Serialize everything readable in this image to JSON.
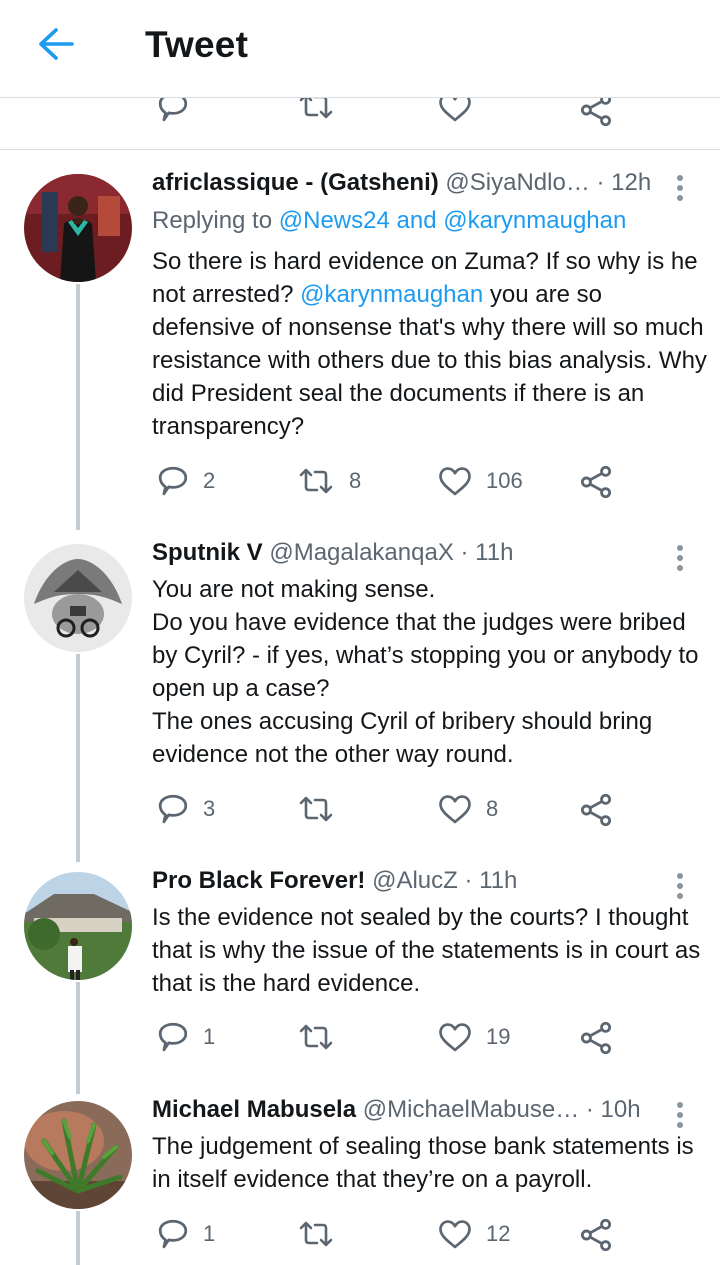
{
  "header": {
    "title": "Tweet"
  },
  "tweets": [
    {
      "name": "africlassique - (Gatsheni)",
      "handle": "@SiyaNdlo…",
      "time": "· 12h",
      "replying_label": "Replying to",
      "replying_to_1": "@News24",
      "replying_and": "and",
      "replying_to_2": "@karynmaughan",
      "text_1": "So there is hard evidence on Zuma? If so why is he not arrested?",
      "mention": "@karynmaughan",
      "text_2": "you are so defensive of nonsense that's why there will so much resistance with others due to this bias analysis. Why did President seal the documents if there is an transparency?",
      "replies": "2",
      "retweets": "8",
      "likes": "106"
    },
    {
      "name": "Sputnik V",
      "handle": "@MagalakanqaX",
      "time": "· 11h",
      "line_1": "You are not making sense.",
      "line_2": "Do you have evidence that the judges were bribed by Cyril? - if yes, what’s stopping you or anybody to open up a case?",
      "line_3": "The ones accusing Cyril of bribery should bring evidence not the other way round.",
      "replies": "3",
      "likes": "8"
    },
    {
      "name": "Pro Black Forever!",
      "handle": "@AlucZ",
      "time": "· 11h",
      "text": "Is the evidence not sealed by the courts? I thought that is why the issue of the statements is in court as that is the hard evidence.",
      "replies": "1",
      "likes": "19"
    },
    {
      "name": "Michael Mabusela",
      "handle": "@MichaelMabuse…",
      "time": "· 10h",
      "text": "The judgement of sealing those bank statements is in itself evidence that they’re on a payroll.",
      "replies": "1",
      "likes": "12"
    }
  ],
  "colors": {
    "link": "#1d9bf0",
    "back_arrow": "#1d9bf0",
    "muted": "#5b6670",
    "thread_line": "#c4ccd3"
  }
}
